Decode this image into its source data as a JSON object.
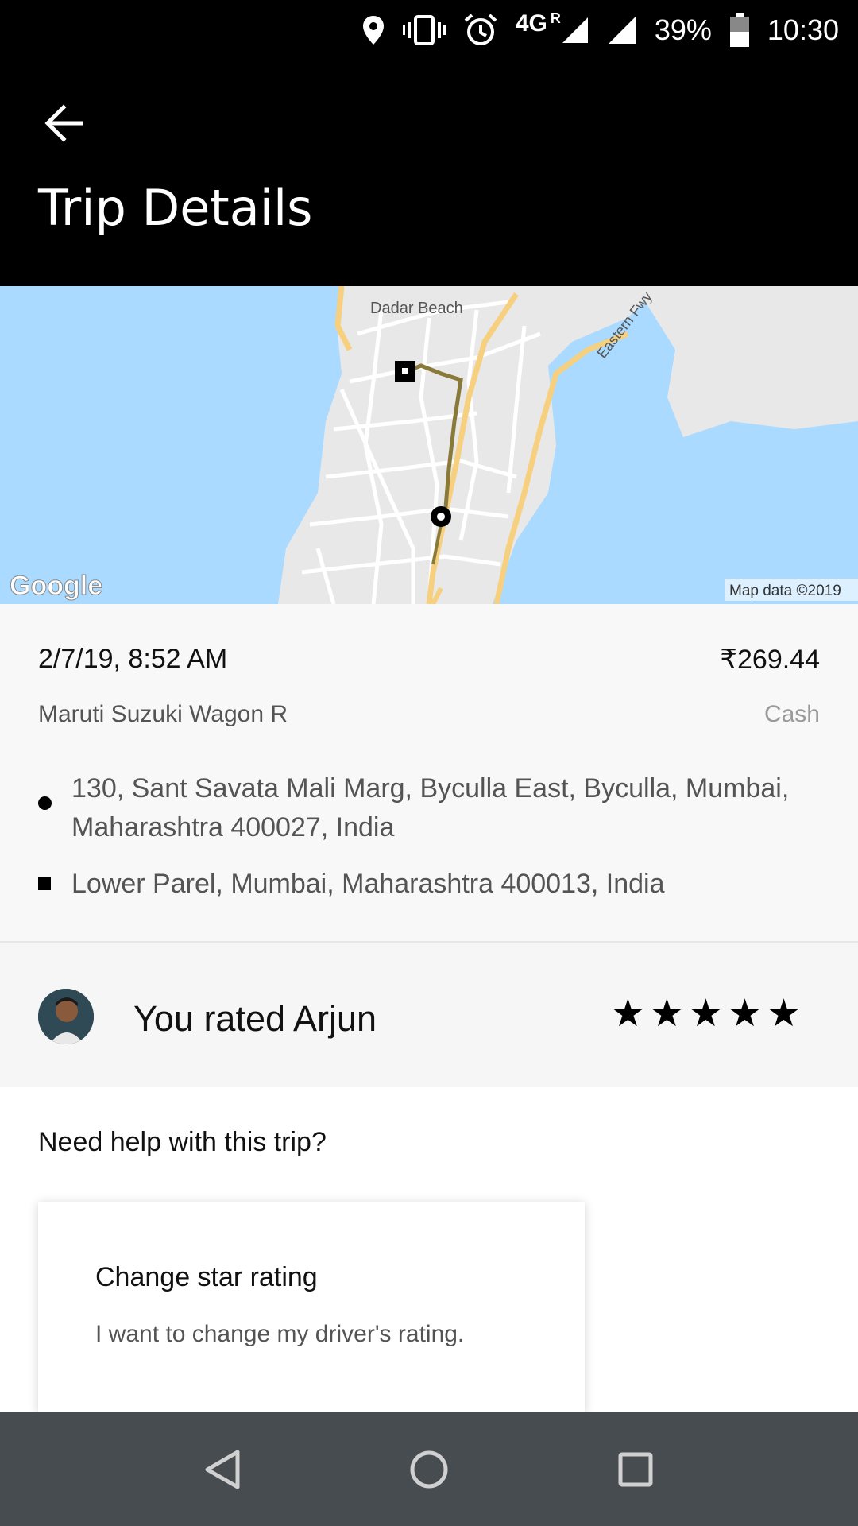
{
  "status_bar": {
    "network": "4G",
    "roaming": "R",
    "battery": "39%",
    "time": "10:30",
    "icons": [
      "location-icon",
      "vibrate-icon",
      "alarm-icon",
      "signal-icon",
      "signal-icon",
      "battery-icon"
    ]
  },
  "header": {
    "title": "Trip Details",
    "back_icon": "arrow-left-icon"
  },
  "map": {
    "place_label": "Dadar Beach",
    "road_label": "Eastern Fwy",
    "attribution": "Map data ©2019",
    "logo": "Google"
  },
  "trip": {
    "datetime": "2/7/19, 8:52 AM",
    "fare": "₹269.44",
    "vehicle": "Maruti Suzuki Wagon R",
    "payment": "Cash",
    "pickup": "130, Sant Savata Mali Marg, Byculla East, Byculla, Mumbai, Maharashtra 400027, India",
    "dropoff": "Lower Parel, Mumbai, Maharashtra 400013, India"
  },
  "rating": {
    "label": "You rated Arjun",
    "stars": 5,
    "star_glyph": "★"
  },
  "help": {
    "title": "Need help with this trip?",
    "card": {
      "title": "Change star rating",
      "description": "I want to change my driver's rating."
    }
  },
  "colors": {
    "header_bg": "#000000",
    "map_water": "#aadaff",
    "map_land": "#e8e8e8",
    "route": "#8a7a3a",
    "nav_bar": "#474c51"
  }
}
